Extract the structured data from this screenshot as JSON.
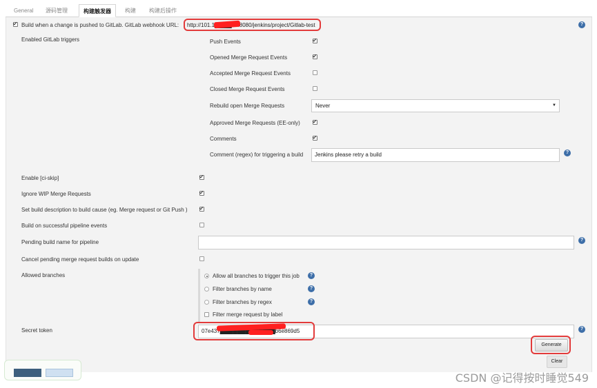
{
  "tabs": [
    "General",
    "源码管理",
    "构建触发器",
    "构建",
    "构建后操作"
  ],
  "active_tab_index": 2,
  "main_trigger": {
    "label": "Build when a change is pushed to GitLab. GitLab webhook URL:",
    "checked": true,
    "url": "http://101.1▇▇▇▇06:8080/jenkins/project/Gitlab-test"
  },
  "enabled_triggers_label": "Enabled GitLab triggers",
  "triggers": [
    {
      "label": "Push Events",
      "checked": true
    },
    {
      "label": "Opened Merge Request Events",
      "checked": true
    },
    {
      "label": "Accepted Merge Request Events",
      "checked": false
    },
    {
      "label": "Closed Merge Request Events",
      "checked": false
    },
    {
      "label": "Rebuild open Merge Requests",
      "select": "Never"
    },
    {
      "label": "Approved Merge Requests (EE-only)",
      "checked": true
    },
    {
      "label": "Comments",
      "checked": true
    },
    {
      "label": "Comment (regex) for triggering a build",
      "input": "Jenkins please retry a build"
    }
  ],
  "options": [
    {
      "label": "Enable [ci-skip]",
      "checked": true
    },
    {
      "label": "Ignore WIP Merge Requests",
      "checked": true
    },
    {
      "label": "Set build description to build cause (eg. Merge request or Git Push )",
      "checked": true
    },
    {
      "label": "Build on successful pipeline events",
      "checked": false
    },
    {
      "label": "Pending build name for pipeline",
      "input": ""
    },
    {
      "label": "Cancel pending merge request builds on update",
      "checked": false
    }
  ],
  "allowed_branches": {
    "label": "Allowed branches",
    "choices": [
      {
        "label": "Allow all branches to trigger this job",
        "selected": true
      },
      {
        "label": "Filter branches by name",
        "selected": false
      },
      {
        "label": "Filter branches by regex",
        "selected": false
      }
    ],
    "merge_label_filter": {
      "label": "Filter merge request by label",
      "checked": false
    }
  },
  "secret_token": {
    "label": "Secret token",
    "value": "07e437▇▇▇▇▇▇▇▇▇▇▇▇▇b6e869d5"
  },
  "buttons": {
    "generate": "Generate",
    "clear": "Clear"
  },
  "watermark": "CSDN @记得按时睡觉549",
  "colors": {
    "highlight": "#e23a3a",
    "help": "#3d6ea8"
  }
}
